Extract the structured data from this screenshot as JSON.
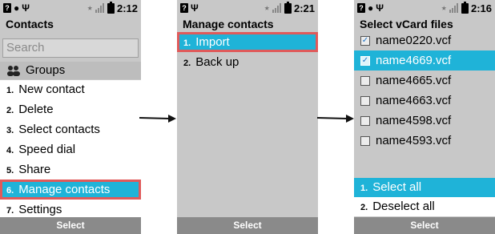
{
  "status": {
    "screen1_time": "2:12",
    "screen2_time": "2:21",
    "screen3_time": "2:16"
  },
  "screen1": {
    "title": "Contacts",
    "search_placeholder": "Search",
    "groups_label": "Groups",
    "items": [
      {
        "num": "1.",
        "label": "New contact"
      },
      {
        "num": "2.",
        "label": "Delete"
      },
      {
        "num": "3.",
        "label": "Select contacts"
      },
      {
        "num": "4.",
        "label": "Speed dial"
      },
      {
        "num": "5.",
        "label": "Share"
      },
      {
        "num": "6.",
        "label": "Manage contacts"
      },
      {
        "num": "7.",
        "label": "Settings"
      }
    ],
    "softkey": "Select"
  },
  "screen2": {
    "title": "Manage contacts",
    "items": [
      {
        "num": "1.",
        "label": "Import"
      },
      {
        "num": "2.",
        "label": "Back up"
      }
    ],
    "softkey": "Select"
  },
  "screen3": {
    "title": "Select vCard files",
    "files": [
      {
        "name": "name0220.vcf",
        "checked": true
      },
      {
        "name": "name4669.vcf",
        "checked": true
      },
      {
        "name": "name4665.vcf",
        "checked": false
      },
      {
        "name": "name4663.vcf",
        "checked": false
      },
      {
        "name": "name4598.vcf",
        "checked": false
      },
      {
        "name": "name4593.vcf",
        "checked": false
      }
    ],
    "menu": [
      {
        "num": "1.",
        "label": "Select all"
      },
      {
        "num": "2.",
        "label": "Deselect all"
      }
    ],
    "softkey": "Select"
  },
  "colors": {
    "accent": "#1fb3d8",
    "highlight_box": "#e05a5a",
    "softkey_bg": "#8a8a8a",
    "screen_bg": "#c8c8c8"
  },
  "icons": [
    "sim-icon",
    "message-icon",
    "usb-icon",
    "bluetooth-icon",
    "signal-icon",
    "battery-icon",
    "arrow-right-icon",
    "checkbox-checked-icon",
    "checkbox-unchecked-icon",
    "groups-icon"
  ]
}
